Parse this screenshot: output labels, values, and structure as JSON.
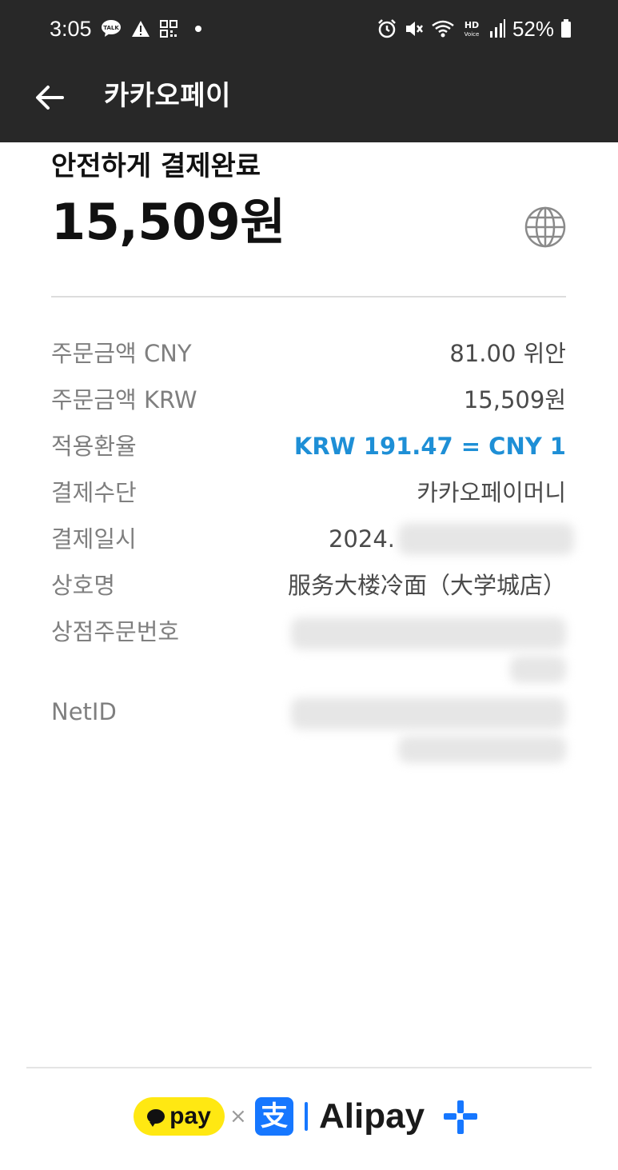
{
  "status_bar": {
    "time": "3:05",
    "battery_percent": "52%",
    "left_icons": [
      "talk-icon",
      "warning-icon",
      "qr-icon",
      "dot-icon"
    ],
    "right_icons": [
      "alarm-icon",
      "mute-icon",
      "wifi-icon",
      "hd-voice-icon",
      "signal-icon",
      "battery-icon"
    ]
  },
  "app_bar": {
    "title": "카카오페이",
    "back_icon": "arrow-left-icon"
  },
  "summary": {
    "label": "안전하게 결제완료",
    "amount": "15,509원",
    "globe_icon": "globe-icon"
  },
  "details": [
    {
      "label": "주문금액 CNY",
      "value": "81.00 위안"
    },
    {
      "label": "주문금액 KRW",
      "value": "15,509원"
    },
    {
      "label": "적용환율",
      "value": "KRW 191.47 = CNY 1"
    },
    {
      "label": "결제수단",
      "value": "카카오페이머니"
    },
    {
      "label": "결제일시",
      "value": "2024."
    },
    {
      "label": "상호명",
      "value": "服务大楼冷面（大学城店）"
    },
    {
      "label": "상점주문번호",
      "value": ""
    },
    {
      "label": "NetID",
      "value": ""
    }
  ],
  "footer": {
    "kakaopay_text": "pay",
    "separator": "×",
    "alipay_symbol": "支",
    "alipay_text": "Alipay"
  },
  "colors": {
    "header_bg": "#282828",
    "accent_blue": "#1e8fd6",
    "kakao_yellow": "#ffe812",
    "alipay_blue": "#1677ff"
  }
}
